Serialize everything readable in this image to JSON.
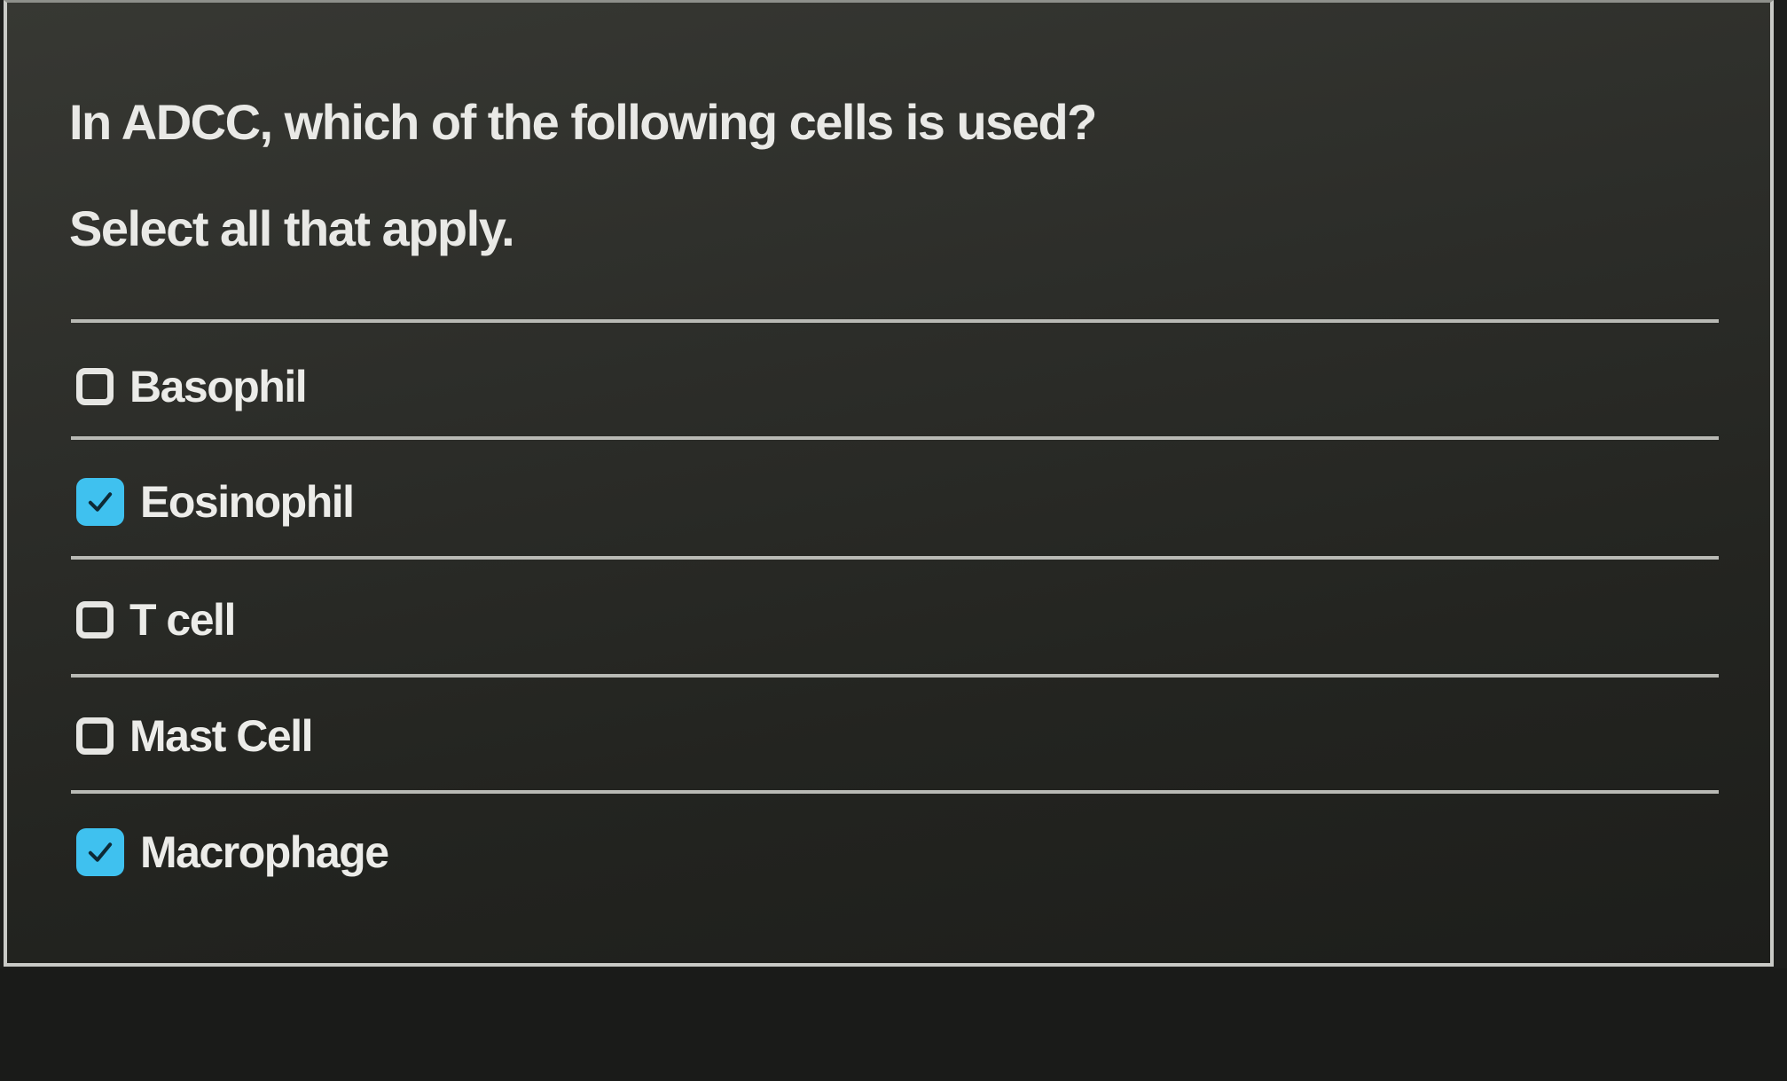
{
  "question": {
    "text": "In ADCC, which of the following cells is used?",
    "instruction": "Select all that apply."
  },
  "options": [
    {
      "label": "Basophil",
      "checked": false
    },
    {
      "label": "Eosinophil",
      "checked": true
    },
    {
      "label": "T cell",
      "checked": false
    },
    {
      "label": "Mast Cell",
      "checked": false
    },
    {
      "label": "Macrophage",
      "checked": true
    }
  ],
  "colors": {
    "checkbox_checked": "#3fc1ef",
    "text": "#e9e9e6",
    "background": "#2c2d29"
  },
  "icons": {
    "checked": "checkmark-icon",
    "unchecked": "empty-checkbox-icon"
  }
}
